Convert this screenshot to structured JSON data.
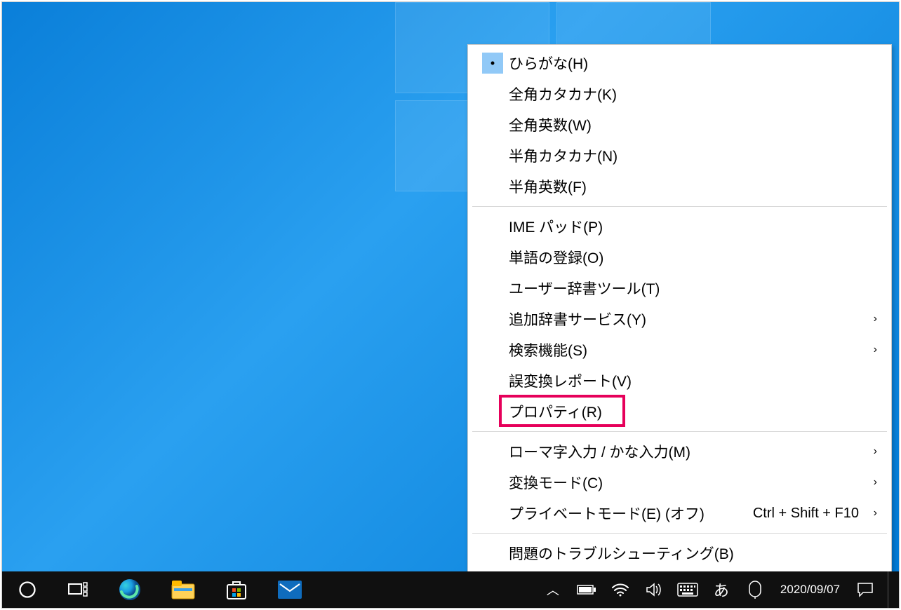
{
  "menu": {
    "group_input_modes": [
      {
        "label": "ひらがな(H)",
        "selected": true
      },
      {
        "label": "全角カタカナ(K)"
      },
      {
        "label": "全角英数(W)"
      },
      {
        "label": "半角カタカナ(N)"
      },
      {
        "label": "半角英数(F)"
      }
    ],
    "group_tools": [
      {
        "label": "IME パッド(P)"
      },
      {
        "label": "単語の登録(O)"
      },
      {
        "label": "ユーザー辞書ツール(T)"
      },
      {
        "label": "追加辞書サービス(Y)",
        "submenu": true
      },
      {
        "label": "検索機能(S)",
        "submenu": true
      },
      {
        "label": "誤変換レポート(V)"
      },
      {
        "label": "プロパティ(R)",
        "highlighted": true
      }
    ],
    "group_settings": [
      {
        "label": "ローマ字入力 / かな入力(M)",
        "submenu": true
      },
      {
        "label": "変換モード(C)",
        "submenu": true
      },
      {
        "label": "プライベートモード(E) (オフ)",
        "hotkey": "Ctrl + Shift + F10",
        "submenu": true
      }
    ],
    "group_help": [
      {
        "label": "問題のトラブルシューティング(B)"
      }
    ]
  },
  "taskbar": {
    "ime_indicator": "あ",
    "date": "2020/09/07"
  },
  "highlight_color": "#e6005a"
}
